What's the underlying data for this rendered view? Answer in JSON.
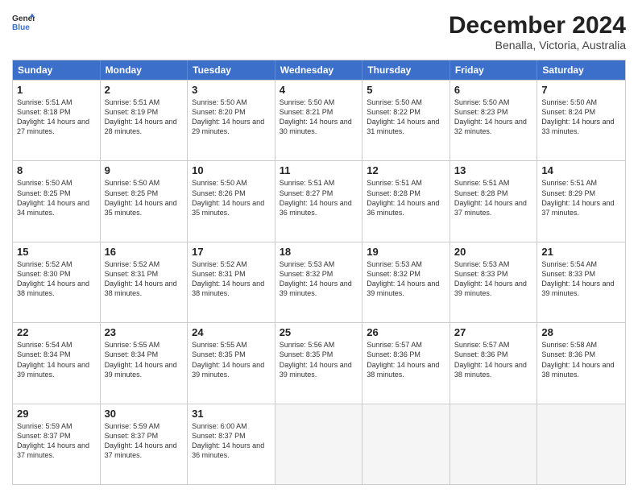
{
  "header": {
    "logo_line1": "General",
    "logo_line2": "Blue",
    "month": "December 2024",
    "location": "Benalla, Victoria, Australia"
  },
  "days_of_week": [
    "Sunday",
    "Monday",
    "Tuesday",
    "Wednesday",
    "Thursday",
    "Friday",
    "Saturday"
  ],
  "weeks": [
    [
      {
        "day": "1",
        "sunrise": "5:51 AM",
        "sunset": "8:18 PM",
        "daylight": "14 hours and 27 minutes."
      },
      {
        "day": "2",
        "sunrise": "5:51 AM",
        "sunset": "8:19 PM",
        "daylight": "14 hours and 28 minutes."
      },
      {
        "day": "3",
        "sunrise": "5:50 AM",
        "sunset": "8:20 PM",
        "daylight": "14 hours and 29 minutes."
      },
      {
        "day": "4",
        "sunrise": "5:50 AM",
        "sunset": "8:21 PM",
        "daylight": "14 hours and 30 minutes."
      },
      {
        "day": "5",
        "sunrise": "5:50 AM",
        "sunset": "8:22 PM",
        "daylight": "14 hours and 31 minutes."
      },
      {
        "day": "6",
        "sunrise": "5:50 AM",
        "sunset": "8:23 PM",
        "daylight": "14 hours and 32 minutes."
      },
      {
        "day": "7",
        "sunrise": "5:50 AM",
        "sunset": "8:24 PM",
        "daylight": "14 hours and 33 minutes."
      }
    ],
    [
      {
        "day": "8",
        "sunrise": "5:50 AM",
        "sunset": "8:25 PM",
        "daylight": "14 hours and 34 minutes."
      },
      {
        "day": "9",
        "sunrise": "5:50 AM",
        "sunset": "8:25 PM",
        "daylight": "14 hours and 35 minutes."
      },
      {
        "day": "10",
        "sunrise": "5:50 AM",
        "sunset": "8:26 PM",
        "daylight": "14 hours and 35 minutes."
      },
      {
        "day": "11",
        "sunrise": "5:51 AM",
        "sunset": "8:27 PM",
        "daylight": "14 hours and 36 minutes."
      },
      {
        "day": "12",
        "sunrise": "5:51 AM",
        "sunset": "8:28 PM",
        "daylight": "14 hours and 36 minutes."
      },
      {
        "day": "13",
        "sunrise": "5:51 AM",
        "sunset": "8:28 PM",
        "daylight": "14 hours and 37 minutes."
      },
      {
        "day": "14",
        "sunrise": "5:51 AM",
        "sunset": "8:29 PM",
        "daylight": "14 hours and 37 minutes."
      }
    ],
    [
      {
        "day": "15",
        "sunrise": "5:52 AM",
        "sunset": "8:30 PM",
        "daylight": "14 hours and 38 minutes."
      },
      {
        "day": "16",
        "sunrise": "5:52 AM",
        "sunset": "8:31 PM",
        "daylight": "14 hours and 38 minutes."
      },
      {
        "day": "17",
        "sunrise": "5:52 AM",
        "sunset": "8:31 PM",
        "daylight": "14 hours and 38 minutes."
      },
      {
        "day": "18",
        "sunrise": "5:53 AM",
        "sunset": "8:32 PM",
        "daylight": "14 hours and 39 minutes."
      },
      {
        "day": "19",
        "sunrise": "5:53 AM",
        "sunset": "8:32 PM",
        "daylight": "14 hours and 39 minutes."
      },
      {
        "day": "20",
        "sunrise": "5:53 AM",
        "sunset": "8:33 PM",
        "daylight": "14 hours and 39 minutes."
      },
      {
        "day": "21",
        "sunrise": "5:54 AM",
        "sunset": "8:33 PM",
        "daylight": "14 hours and 39 minutes."
      }
    ],
    [
      {
        "day": "22",
        "sunrise": "5:54 AM",
        "sunset": "8:34 PM",
        "daylight": "14 hours and 39 minutes."
      },
      {
        "day": "23",
        "sunrise": "5:55 AM",
        "sunset": "8:34 PM",
        "daylight": "14 hours and 39 minutes."
      },
      {
        "day": "24",
        "sunrise": "5:55 AM",
        "sunset": "8:35 PM",
        "daylight": "14 hours and 39 minutes."
      },
      {
        "day": "25",
        "sunrise": "5:56 AM",
        "sunset": "8:35 PM",
        "daylight": "14 hours and 39 minutes."
      },
      {
        "day": "26",
        "sunrise": "5:57 AM",
        "sunset": "8:36 PM",
        "daylight": "14 hours and 38 minutes."
      },
      {
        "day": "27",
        "sunrise": "5:57 AM",
        "sunset": "8:36 PM",
        "daylight": "14 hours and 38 minutes."
      },
      {
        "day": "28",
        "sunrise": "5:58 AM",
        "sunset": "8:36 PM",
        "daylight": "14 hours and 38 minutes."
      }
    ],
    [
      {
        "day": "29",
        "sunrise": "5:59 AM",
        "sunset": "8:37 PM",
        "daylight": "14 hours and 37 minutes."
      },
      {
        "day": "30",
        "sunrise": "5:59 AM",
        "sunset": "8:37 PM",
        "daylight": "14 hours and 37 minutes."
      },
      {
        "day": "31",
        "sunrise": "6:00 AM",
        "sunset": "8:37 PM",
        "daylight": "14 hours and 36 minutes."
      },
      null,
      null,
      null,
      null
    ]
  ]
}
